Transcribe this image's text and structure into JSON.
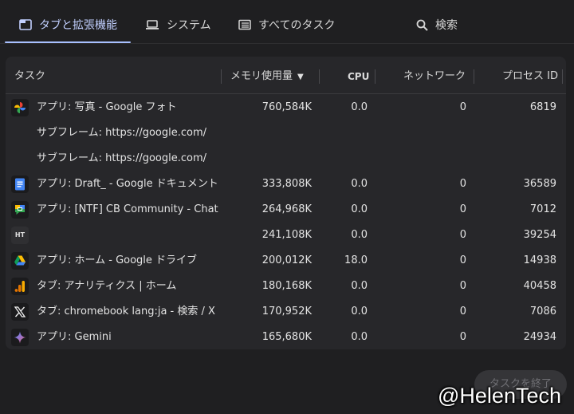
{
  "tabs": [
    {
      "label": "タブと拡張機能",
      "icon": "tab-window-icon",
      "active": true
    },
    {
      "label": "システム",
      "icon": "laptop-icon",
      "active": false
    },
    {
      "label": "すべてのタスク",
      "icon": "list-icon",
      "active": false
    }
  ],
  "search": {
    "label": "検索",
    "icon": "search-icon"
  },
  "columns": {
    "task": "タスク",
    "memory": "メモリ使用量",
    "sort_indicator": "▼",
    "cpu": "CPU",
    "network": "ネットワーク",
    "pid": "プロセス ID"
  },
  "rows": [
    {
      "icon": "google-photos-icon",
      "task": "アプリ: 写真 - Google フォト",
      "memory": "760,584K",
      "cpu": "0.0",
      "network": "0",
      "pid": "6819"
    },
    {
      "icon": "",
      "task": "サブフレーム: https://google.com/",
      "memory": "",
      "cpu": "",
      "network": "",
      "pid": ""
    },
    {
      "icon": "",
      "task": "サブフレーム: https://google.com/",
      "memory": "",
      "cpu": "",
      "network": "",
      "pid": ""
    },
    {
      "icon": "google-docs-icon",
      "task": "アプリ: Draft_ - Google ドキュメント",
      "memory": "333,808K",
      "cpu": "0.0",
      "network": "0",
      "pid": "36589"
    },
    {
      "icon": "google-chat-icon",
      "task": "アプリ: [NTF] CB Community - Chat",
      "memory": "264,968K",
      "cpu": "0.0",
      "network": "0",
      "pid": "7012"
    },
    {
      "icon": "ht-logo-icon",
      "task": "",
      "memory": "241,108K",
      "cpu": "0.0",
      "network": "0",
      "pid": "39254"
    },
    {
      "icon": "google-drive-icon",
      "task": "アプリ: ホーム - Google ドライブ",
      "memory": "200,012K",
      "cpu": "18.0",
      "network": "0",
      "pid": "14938"
    },
    {
      "icon": "google-analytics-icon",
      "task": "タブ: アナリティクス | ホーム",
      "memory": "180,168K",
      "cpu": "0.0",
      "network": "0",
      "pid": "40458"
    },
    {
      "icon": "x-logo-icon",
      "task": "タブ: chromebook lang:ja - 検索 / X",
      "memory": "170,952K",
      "cpu": "0.0",
      "network": "0",
      "pid": "7086"
    },
    {
      "icon": "gemini-icon",
      "task": "アプリ: Gemini",
      "memory": "165,680K",
      "cpu": "0.0",
      "network": "0",
      "pid": "24934"
    }
  ],
  "ht_logo_text": "HT",
  "end_task_button": "タスクを終了",
  "watermark": "@HelenTech"
}
